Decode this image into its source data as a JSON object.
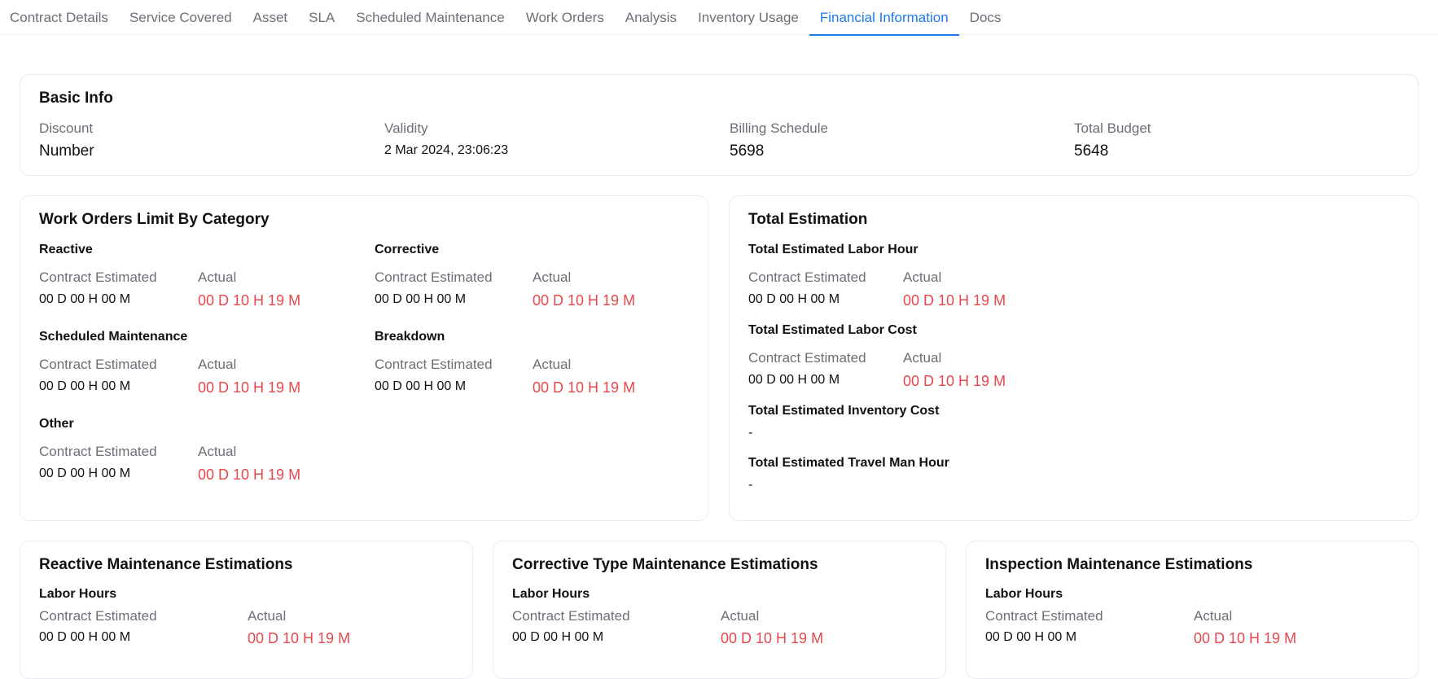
{
  "tabs": [
    {
      "label": "Contract Details"
    },
    {
      "label": "Service Covered"
    },
    {
      "label": "Asset"
    },
    {
      "label": "SLA"
    },
    {
      "label": "Scheduled Maintenance"
    },
    {
      "label": "Work Orders"
    },
    {
      "label": "Analysis"
    },
    {
      "label": "Inventory Usage"
    },
    {
      "label": "Financial Information"
    },
    {
      "label": "Docs"
    }
  ],
  "active_tab": "Financial Information",
  "colors": {
    "accent": "#1c7be8",
    "actual_red": "#e5484d",
    "label_gray": "#6b6f76"
  },
  "basic_info": {
    "title": "Basic Info",
    "fields": [
      {
        "label": "Discount",
        "value": "Number"
      },
      {
        "label": "Validity",
        "value": "2 Mar 2024, 23:06:23"
      },
      {
        "label": "Billing Schedule",
        "value": "5698"
      },
      {
        "label": "Total Budget",
        "value": "5648"
      }
    ]
  },
  "work_orders_limit": {
    "title": "Work Orders Limit By Category",
    "categories": [
      {
        "name": "Reactive",
        "est_label": "Contract Estimated",
        "est_value": "00 D 00 H 00 M",
        "act_label": "Actual",
        "act_value": "00 D 10 H 19 M"
      },
      {
        "name": "Corrective",
        "est_label": "Contract Estimated",
        "est_value": "00 D 00 H 00 M",
        "act_label": "Actual",
        "act_value": "00 D 10 H 19 M"
      },
      {
        "name": "Scheduled Maintenance",
        "est_label": "Contract Estimated",
        "est_value": "00 D 00 H 00 M",
        "act_label": "Actual",
        "act_value": "00 D 10 H 19 M"
      },
      {
        "name": "Breakdown",
        "est_label": "Contract Estimated",
        "est_value": "00 D 00 H 00 M",
        "act_label": "Actual",
        "act_value": "00 D 10 H 19 M"
      },
      {
        "name": "Other",
        "est_label": "Contract Estimated",
        "est_value": "00 D 00 H 00 M",
        "act_label": "Actual",
        "act_value": "00 D 10 H 19 M"
      }
    ]
  },
  "total_estimation": {
    "title": "Total Estimation",
    "labor_hour": {
      "title": "Total Estimated Labor Hour",
      "est_label": "Contract Estimated",
      "est_value": "00 D 00 H 00 M",
      "act_label": "Actual",
      "act_value": "00 D 10 H 19 M"
    },
    "labor_cost": {
      "title": "Total Estimated Labor Cost",
      "est_label": "Contract Estimated",
      "est_value": "00 D 00 H 00 M",
      "act_label": "Actual",
      "act_value": "00 D 10 H 19 M"
    },
    "inventory_cost": {
      "title": "Total Estimated Inventory Cost",
      "value": "-"
    },
    "travel_man_hour": {
      "title": "Total Estimated Travel Man Hour",
      "value": "-"
    }
  },
  "maintenance_estimations": [
    {
      "title": "Reactive Maintenance Estimations",
      "section": "Labor Hours",
      "est_label": "Contract Estimated",
      "est_value": "00 D 00 H 00 M",
      "act_label": "Actual",
      "act_value": "00 D 10 H 19 M"
    },
    {
      "title": "Corrective Type Maintenance Estimations",
      "section": "Labor Hours",
      "est_label": "Contract Estimated",
      "est_value": "00 D 00 H 00 M",
      "act_label": "Actual",
      "act_value": "00 D 10 H 19 M"
    },
    {
      "title": "Inspection Maintenance Estimations",
      "section": "Labor Hours",
      "est_label": "Contract Estimated",
      "est_value": "00 D 00 H 00 M",
      "act_label": "Actual",
      "act_value": "00 D 10 H 19 M"
    }
  ]
}
